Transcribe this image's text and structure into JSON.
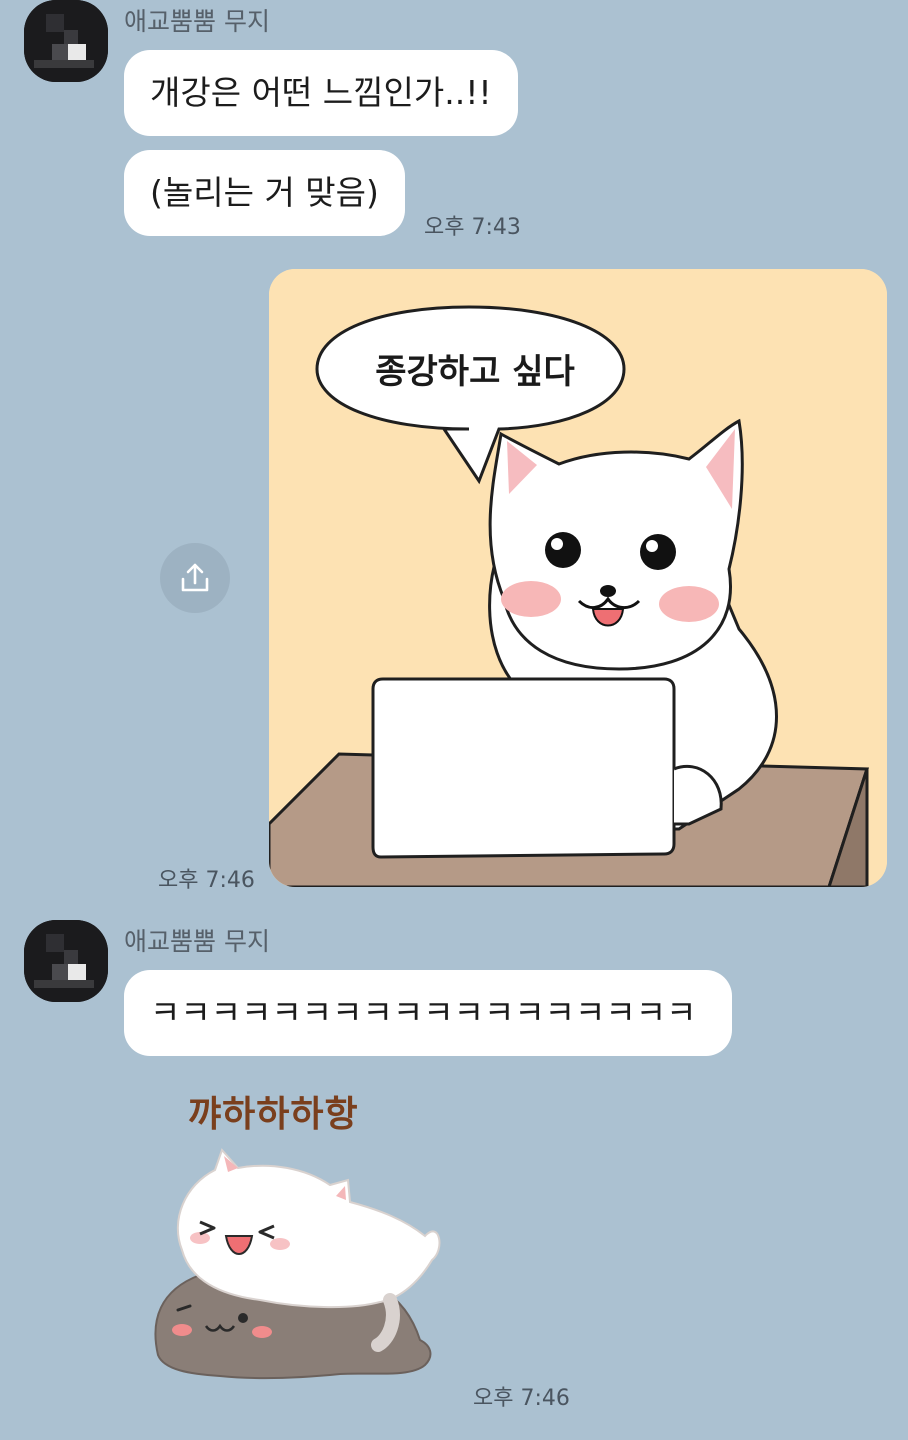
{
  "messages": [
    {
      "sender": "애교뿜뿜 무지",
      "bubbles": [
        "개강은 어떤 느낌인가..!!",
        "(놀리는 거 맞음)"
      ],
      "time": "오후 7:43"
    },
    {
      "image": {
        "speech": "종강하고 싶다"
      },
      "time": "오후 7:46",
      "share_icon": "share-icon"
    },
    {
      "sender": "애교뿜뿜 무지",
      "bubbles": [
        "ㅋㅋㅋㅋㅋㅋㅋㅋㅋㅋㅋㅋㅋㅋㅋㅋㅋㅋ"
      ],
      "sticker": {
        "text": "꺄하하하항"
      },
      "time": "오후 7:46"
    }
  ],
  "colors": {
    "background": "#abc1d1",
    "bubble": "#ffffff",
    "photo_background": "#fde2b3"
  }
}
